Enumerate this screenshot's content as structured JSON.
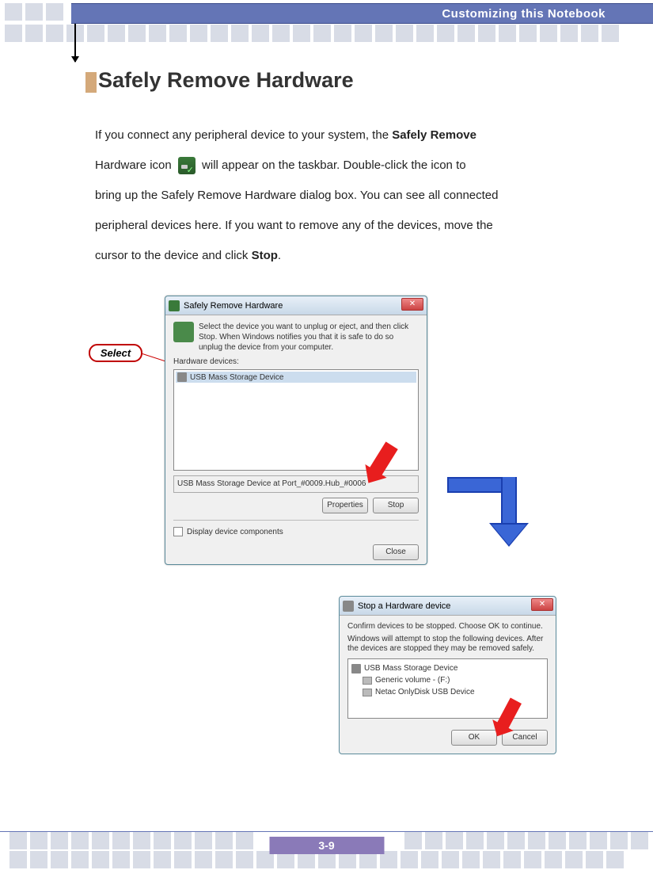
{
  "header": {
    "title": "Customizing this Notebook"
  },
  "section": {
    "title": "Safely Remove Hardware"
  },
  "paragraph": {
    "p1a": "If you connect any peripheral device to your system, the ",
    "p1b_bold": "Safely Remove",
    "p2a": "Hardware icon ",
    "p2b": " will appear on the taskbar.  Double-click the icon to",
    "p3": "bring up the Safely Remove Hardware dialog box.  You can see all connected",
    "p4": "peripheral devices here.  If you want to remove any of the devices, move the",
    "p5a": "cursor to the device and click ",
    "p5b_bold": "Stop",
    "p5c": "."
  },
  "callout": {
    "select": "Select"
  },
  "dialog1": {
    "title": "Safely Remove Hardware",
    "instruction": "Select the device you want to unplug or eject, and then click Stop. When Windows notifies you that it is safe to do so unplug the device from your computer.",
    "devices_label": "Hardware devices:",
    "device_item": "USB Mass Storage Device",
    "location": "USB Mass Storage Device at Port_#0009.Hub_#0006",
    "btn_properties": "Properties",
    "btn_stop": "Stop",
    "checkbox_label": "Display device components",
    "btn_close": "Close"
  },
  "dialog2": {
    "title": "Stop a Hardware device",
    "line1": "Confirm devices to be stopped. Choose OK to continue.",
    "line2": "Windows will attempt to stop the following devices. After the devices are stopped they may be removed safely.",
    "item1": "USB Mass Storage Device",
    "item2": "Generic volume - (F:)",
    "item3": "Netac OnlyDisk USB Device",
    "btn_ok": "OK",
    "btn_cancel": "Cancel"
  },
  "footer": {
    "page": "3-9"
  }
}
